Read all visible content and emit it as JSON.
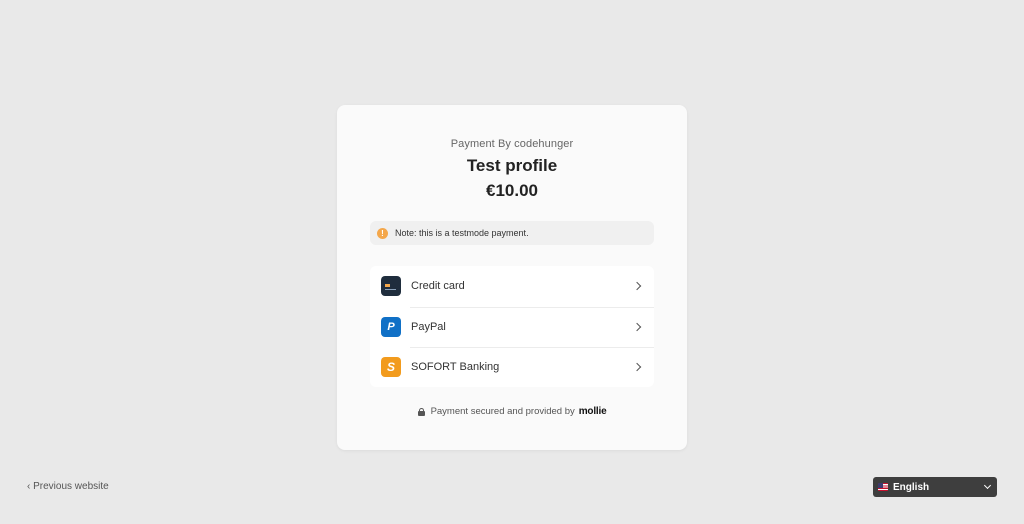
{
  "checkout": {
    "merchant_line": "Payment By codehunger",
    "profile_name": "Test profile",
    "amount": "€10.00",
    "note": "Note: this is a testmode payment.",
    "methods": [
      {
        "label": "Credit card",
        "icon": "credit-card-icon"
      },
      {
        "label": "PayPal",
        "icon": "paypal-icon"
      },
      {
        "label": "SOFORT Banking",
        "icon": "sofort-icon"
      }
    ],
    "secured_text": "Payment secured and provided by",
    "brand": "mollie"
  },
  "footer": {
    "previous_website": "‹ Previous website",
    "language": "English"
  },
  "icons": {
    "paypal_glyph": "P",
    "sofort_glyph": "S",
    "info_glyph": "!"
  },
  "colors": {
    "background": "#e9e9e9",
    "card": "#fafafa",
    "info": "#f4a74b",
    "paypal": "#1070c6",
    "sofort": "#f29b1d",
    "language_button": "#3e3e3e"
  }
}
